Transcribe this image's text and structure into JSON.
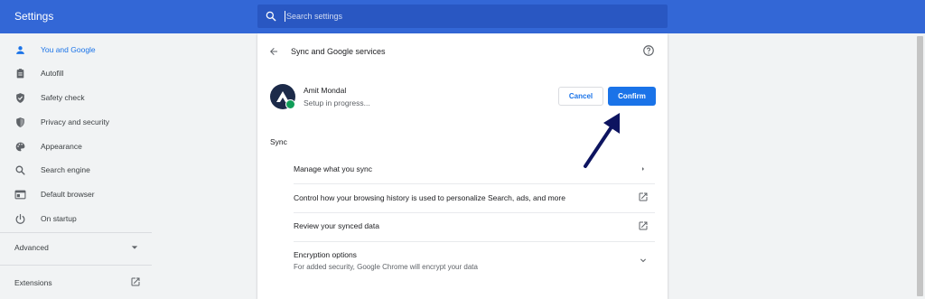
{
  "header": {
    "title": "Settings",
    "search_placeholder": "Search settings"
  },
  "sidebar": {
    "items": [
      {
        "label": "You and Google",
        "icon": "person-icon",
        "active": true
      },
      {
        "label": "Autofill",
        "icon": "clipboard-icon"
      },
      {
        "label": "Safety check",
        "icon": "shield-check-icon"
      },
      {
        "label": "Privacy and security",
        "icon": "shield-icon"
      },
      {
        "label": "Appearance",
        "icon": "palette-icon"
      },
      {
        "label": "Search engine",
        "icon": "search-icon"
      },
      {
        "label": "Default browser",
        "icon": "browser-icon"
      },
      {
        "label": "On startup",
        "icon": "power-icon"
      }
    ],
    "advanced_label": "Advanced",
    "extensions_label": "Extensions"
  },
  "main": {
    "title": "Sync and Google services",
    "account": {
      "name": "Amit Mondal",
      "status": "Setup in progress..."
    },
    "cancel_label": "Cancel",
    "confirm_label": "Confirm",
    "section_label": "Sync",
    "rows": [
      {
        "label": "Manage what you sync",
        "icon": "chevron-right-icon"
      },
      {
        "label": "Control how your browsing history is used to personalize Search, ads, and more",
        "icon": "external-link-icon"
      },
      {
        "label": "Review your synced data",
        "icon": "external-link-icon"
      },
      {
        "label": "Encryption options",
        "sublabel": "For added security, Google Chrome will encrypt your data",
        "icon": "chevron-down-icon"
      }
    ]
  },
  "colors": {
    "topbar": "#3367d6",
    "accent": "#1a73e8",
    "arrow": "#0d1460"
  }
}
